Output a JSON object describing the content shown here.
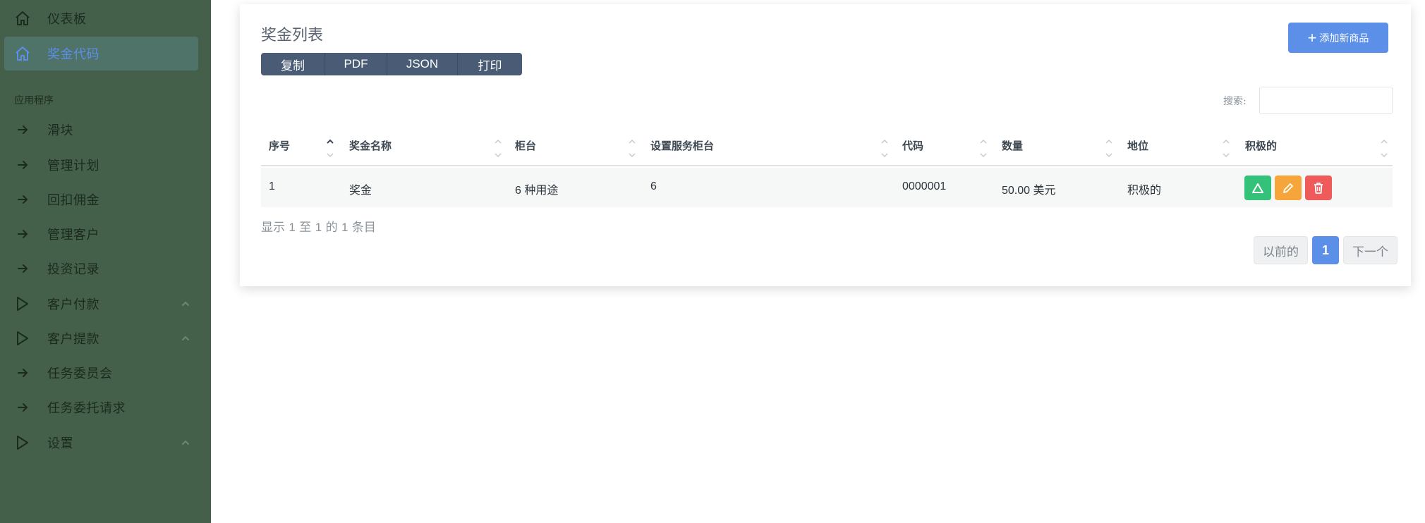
{
  "sidebar": {
    "items_top": [
      {
        "label": "仪表板",
        "icon": "home-icon",
        "active": false
      },
      {
        "label": "奖金代码",
        "icon": "home-icon",
        "active": true
      }
    ],
    "section_label": "应用程序",
    "items": [
      {
        "label": "滑块",
        "icon": "arrow-right-icon"
      },
      {
        "label": "管理计划",
        "icon": "arrow-right-icon"
      },
      {
        "label": "回扣佣金",
        "icon": "arrow-right-icon"
      },
      {
        "label": "管理客户",
        "icon": "arrow-right-icon"
      },
      {
        "label": "投资记录",
        "icon": "arrow-right-icon"
      },
      {
        "label": "客户付款",
        "icon": "play-icon",
        "expandable": true
      },
      {
        "label": "客户提款",
        "icon": "play-icon",
        "expandable": true
      },
      {
        "label": "任务委员会",
        "icon": "arrow-right-icon"
      },
      {
        "label": "任务委托请求",
        "icon": "arrow-right-icon"
      },
      {
        "label": "设置",
        "icon": "play-icon",
        "expandable": true
      }
    ]
  },
  "main": {
    "title": "奖金列表",
    "export_buttons": [
      "复制",
      "PDF",
      "JSON",
      "打印"
    ],
    "add_button": "添加新商品",
    "search_label": "搜索:",
    "search_placeholder": "",
    "table": {
      "columns": [
        "序号",
        "奖金名称",
        "柜台",
        "设置服务柜台",
        "代码",
        "数量",
        "地位",
        "积极的"
      ],
      "rows": [
        {
          "index": "1",
          "name": "奖金",
          "counter_num": "6",
          "counter_unit": "种用途",
          "service_counter": "6",
          "code": "0000001",
          "amount_num": "50.00",
          "amount_unit": "美元",
          "status": "积极的"
        }
      ]
    },
    "info": {
      "prefix": "显示",
      "from": "1",
      "to_word": "至",
      "to": "1",
      "of_word": "的",
      "total": "1",
      "suffix": "条目"
    },
    "pagination": {
      "prev": "以前的",
      "current": "1",
      "next": "下一个"
    }
  },
  "colors": {
    "sidebar_bg": "#45604a",
    "active_item": "#4f7368",
    "accent": "#5b8fe8",
    "group_btn": "#4a5c75",
    "success": "#34c27a",
    "warning": "#f5a53a",
    "danger": "#ef5a5a"
  }
}
